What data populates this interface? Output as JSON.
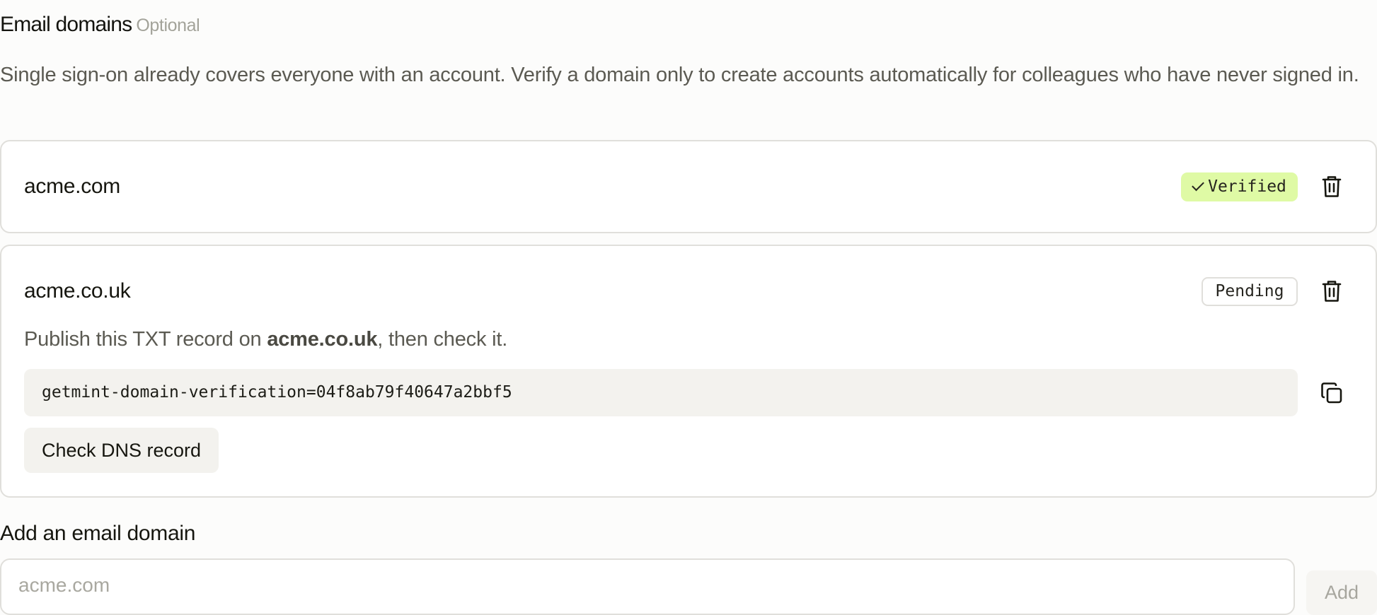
{
  "section": {
    "title": "Email domains",
    "optional_label": "Optional",
    "description": "Single sign-on already covers everyone with an account. Verify a domain only to create accounts automatically for colleagues who have never signed in."
  },
  "domains": [
    {
      "name": "acme.com",
      "status": "Verified",
      "status_icon": "check-icon",
      "status_color": "#dffaa5",
      "delete_icon": "trash-icon"
    },
    {
      "name": "acme.co.uk",
      "status": "Pending",
      "delete_icon": "trash-icon",
      "instructions_prefix": "Publish this TXT record on ",
      "instructions_domain": "acme.co.uk",
      "instructions_suffix": ", then check it.",
      "txt_record": "getmint-domain-verification=04f8ab79f40647a2bbf5",
      "copy_icon": "copy-icon",
      "check_button_label": "Check DNS record"
    }
  ],
  "add_domain": {
    "label": "Add an email domain",
    "placeholder": "acme.com",
    "value": "",
    "button_label": "Add"
  }
}
